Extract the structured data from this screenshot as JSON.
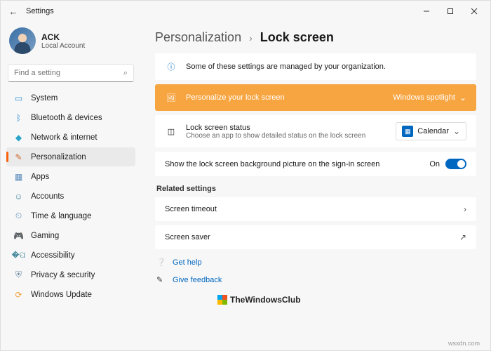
{
  "window": {
    "title": "Settings"
  },
  "profile": {
    "name": "ACK",
    "sub": "Local Account"
  },
  "search": {
    "placeholder": "Find a setting"
  },
  "nav": {
    "system": "System",
    "bluetooth": "Bluetooth & devices",
    "network": "Network & internet",
    "personalization": "Personalization",
    "apps": "Apps",
    "accounts": "Accounts",
    "time": "Time & language",
    "gaming": "Gaming",
    "accessibility": "Accessibility",
    "privacy": "Privacy & security",
    "update": "Windows Update"
  },
  "crumb": {
    "parent": "Personalization",
    "current": "Lock screen"
  },
  "info": {
    "text": "Some of these settings are managed by your organization."
  },
  "hl": {
    "title": "Personalize your lock screen",
    "value": "Windows spotlight"
  },
  "status": {
    "title": "Lock screen status",
    "sub": "Choose an app to show detailed status on the lock screen",
    "value": "Calendar"
  },
  "bg": {
    "title": "Show the lock screen background picture on the sign-in screen",
    "state": "On"
  },
  "related": {
    "label": "Related settings",
    "timeout": "Screen timeout",
    "saver": "Screen saver"
  },
  "links": {
    "help": "Get help",
    "feedback": "Give feedback"
  },
  "watermark": "TheWindowsClub",
  "attrib": "wsxdn.com"
}
